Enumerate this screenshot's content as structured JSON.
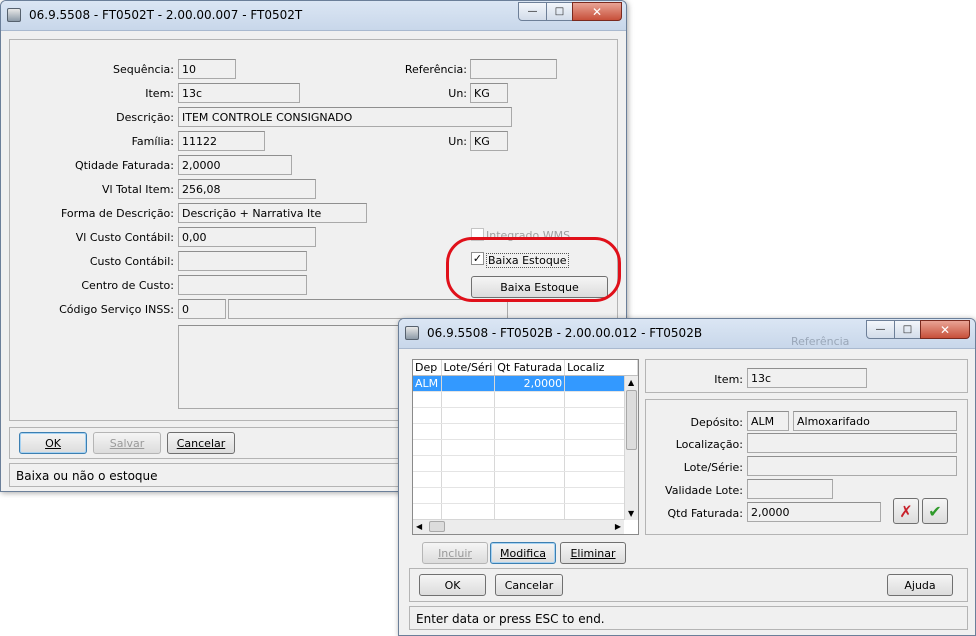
{
  "win1": {
    "title": "06.9.5508 - FT0502T - 2.00.00.007 - FT0502T",
    "fields": {
      "sequencia": {
        "label": "Sequência:",
        "value": "10"
      },
      "referencia": {
        "label": "Referência:",
        "value": ""
      },
      "item": {
        "label": "Item:",
        "value": "13c"
      },
      "un1": {
        "label": "Un:",
        "value": "KG"
      },
      "descricao": {
        "label": "Descrição:",
        "value": "ITEM CONTROLE CONSIGNADO"
      },
      "familia": {
        "label": "Família:",
        "value": "11122"
      },
      "un2": {
        "label": "Un:",
        "value": "KG"
      },
      "qtd_faturada": {
        "label": "Qtidade Faturada:",
        "value": "2,0000"
      },
      "vl_total": {
        "label": "Vl Total Item:",
        "value": "256,08"
      },
      "forma_desc": {
        "label": "Forma de Descrição:",
        "value": "Descrição + Narrativa Ite"
      },
      "vl_custo": {
        "label": "Vl Custo Contábil:",
        "value": "0,00"
      },
      "custo_contabil": {
        "label": "Custo Contábil:",
        "value": ""
      },
      "centro_custo": {
        "label": "Centro de Custo:",
        "value": ""
      },
      "cod_servico": {
        "label": "Código Serviço INSS:",
        "value": "0"
      }
    },
    "integrado_wms": "Integrado WMS",
    "baixa_estoque_check": "Baixa Estoque",
    "baixa_estoque_button": "Baixa Estoque",
    "buttons": {
      "ok": "OK",
      "salvar": "Salvar",
      "cancelar": "Cancelar"
    },
    "status": "Baixa ou não o estoque"
  },
  "win2": {
    "title": "06.9.5508 - FT0502B - 2.00.00.012 - FT0502B",
    "grid": {
      "columns": [
        "Dep",
        "Lote/Séri",
        "Qt Faturada",
        "Localiz"
      ],
      "rows": [
        [
          "ALM",
          "",
          "2,0000",
          ""
        ]
      ]
    },
    "item": {
      "label": "Item:",
      "value": "13c"
    },
    "deposito": {
      "label": "Depósito:",
      "code": "ALM",
      "name": "Almoxarifado"
    },
    "localizacao": {
      "label": "Localização:",
      "value": ""
    },
    "lote_serie": {
      "label": "Lote/Série:",
      "value": ""
    },
    "validade_lote": {
      "label": "Validade Lote:",
      "value": ""
    },
    "qtd_faturada": {
      "label": "Qtd Faturada:",
      "value": "2,0000"
    },
    "grid_buttons": {
      "incluir": "Incluir",
      "modifica": "Modifica",
      "eliminar": "Eliminar"
    },
    "buttons": {
      "ok": "OK",
      "cancelar": "Cancelar",
      "ajuda": "Ajuda"
    },
    "status": "Enter data or press ESC to end.",
    "background_text": "Referência"
  },
  "colors": {
    "highlight_ring": "#e0101a",
    "selection": "#3399ff",
    "titlebar": "#c8d7ea"
  }
}
